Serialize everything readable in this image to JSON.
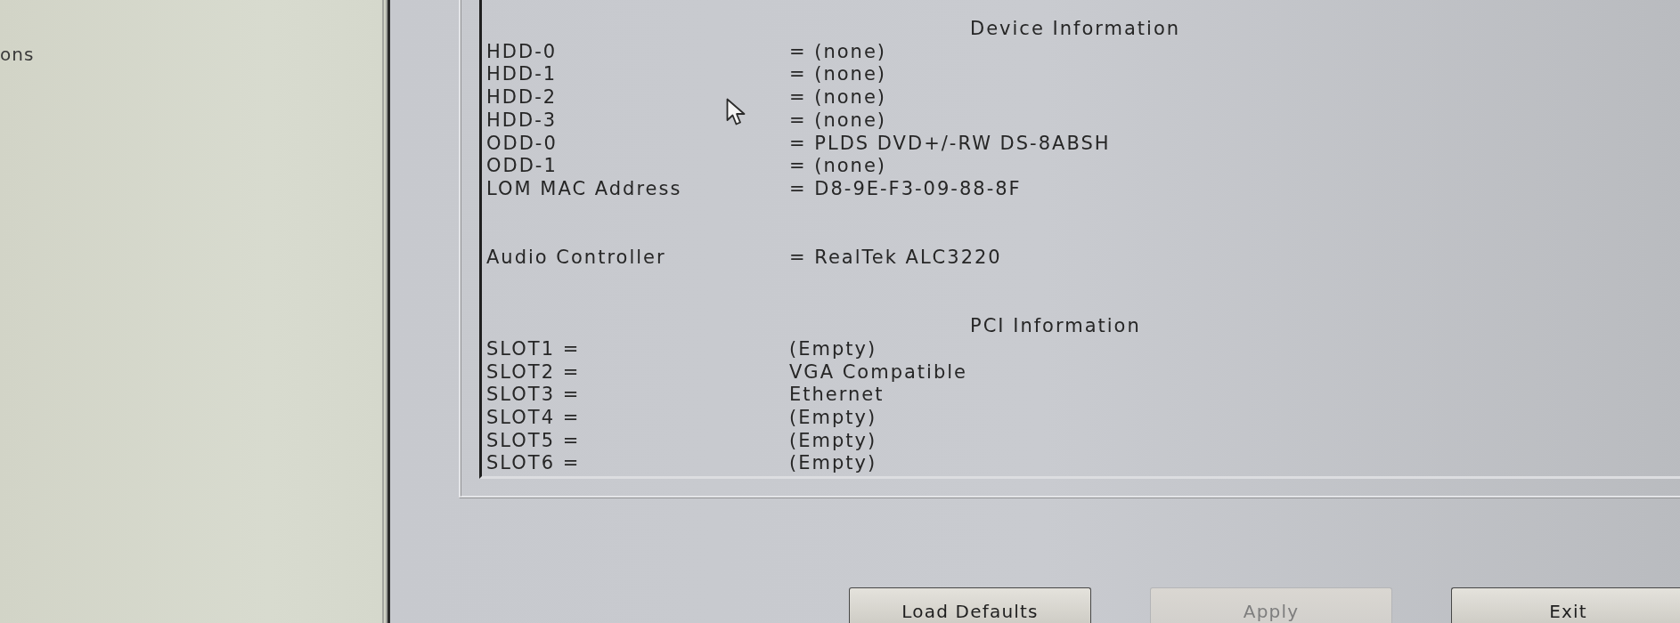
{
  "side_panel": {
    "text": "ons"
  },
  "device_information": {
    "title": "Device Information",
    "rows": [
      {
        "label": "HDD-0",
        "value": "= (none)"
      },
      {
        "label": "HDD-1",
        "value": "= (none)"
      },
      {
        "label": "HDD-2",
        "value": "= (none)"
      },
      {
        "label": "HDD-3",
        "value": "= (none)"
      },
      {
        "label": "ODD-0",
        "value": "= PLDS DVD+/-RW DS-8ABSH"
      },
      {
        "label": "ODD-1",
        "value": "= (none)"
      },
      {
        "label": "LOM MAC Address",
        "value": "= D8-9E-F3-09-88-8F"
      }
    ],
    "audio": {
      "label": "Audio Controller",
      "value": "= RealTek ALC3220"
    }
  },
  "pci_information": {
    "title": "PCI Information",
    "rows": [
      {
        "label": "SLOT1 =",
        "value": "(Empty)"
      },
      {
        "label": "SLOT2 =",
        "value": "VGA Compatible"
      },
      {
        "label": "SLOT3 =",
        "value": "Ethernet"
      },
      {
        "label": "SLOT4 =",
        "value": "(Empty)"
      },
      {
        "label": "SLOT5 =",
        "value": "(Empty)"
      },
      {
        "label": "SLOT6 =",
        "value": "(Empty)"
      }
    ]
  },
  "buttons": [
    {
      "label": "Load Defaults",
      "disabled": false
    },
    {
      "label": "Apply",
      "disabled": true
    },
    {
      "label": "Exit",
      "disabled": false
    }
  ]
}
